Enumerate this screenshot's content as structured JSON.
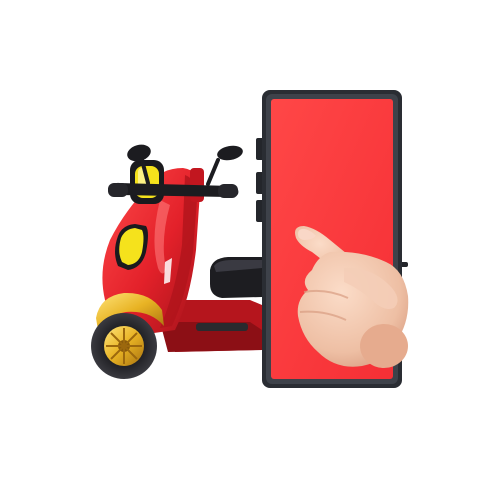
{
  "scene": {
    "subject_icons": [
      "scooter-illustration",
      "smartphone-illustration",
      "pointing-hand-illustration"
    ]
  },
  "colors": {
    "background": "#ffffff",
    "scooter_red": "#e8232a",
    "scooter_red_dark": "#9e0f16",
    "accent_yellow": "#f5e21c",
    "wheel_gold": "#e0a81e",
    "phone_body": "#2a2d33",
    "phone_screen": "#ff3c3c",
    "skin": "#f2c6ad"
  }
}
